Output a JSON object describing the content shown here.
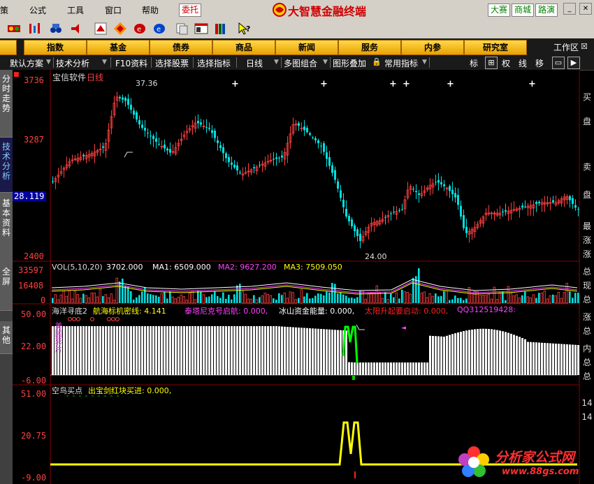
{
  "menu": {
    "items": [
      "策",
      "公式",
      "工具",
      "窗口",
      "帮助"
    ],
    "delegate": "委托",
    "app_title": "大智慧金融终端",
    "right_tabs": [
      "大赛",
      "商城",
      "路演"
    ]
  },
  "nav": {
    "buttons": [
      "指数",
      "基金",
      "债券",
      "商品",
      "新闻",
      "服务",
      "内参",
      "研究室"
    ],
    "workarea": "工作区"
  },
  "chart_toolbar": {
    "items": [
      "默认方案",
      "技术分析",
      "F10资料",
      "选择股票",
      "选择指标",
      "日线",
      "多图组合",
      "图形叠加",
      "常用指标"
    ],
    "boxes": [
      "标",
      "权",
      "线",
      "移"
    ]
  },
  "left_tabs": [
    "分时走势",
    "技术分析",
    "基本资料",
    "全屏",
    "其他"
  ],
  "price_panel": {
    "title": "宝信软件",
    "period": "日线",
    "y_labels": [
      "3736",
      "3287",
      "2400"
    ],
    "current": "28.119",
    "high_label": "37.36",
    "low_label": "24.00",
    "colors": {
      "up": "#ff4040",
      "down": "#00e0e0"
    }
  },
  "vol_panel": {
    "name": "VOL(5,10,20)",
    "value": "3702.000",
    "ma1": "MA1: 6509.000",
    "ma2": "MA2: 9627.200",
    "ma3": "MA3: 7509.050",
    "y_labels": [
      "33597",
      "16408",
      "0"
    ]
  },
  "ind1_panel": {
    "name": "海洋寻底2",
    "items": [
      {
        "text": "航海标机密线: 4.141",
        "color": "#ffff00"
      },
      {
        "text": "泰塔尼克号启航: 0.000,",
        "color": "#ff40ff"
      },
      {
        "text": "冰山资金能量: 0.000,",
        "color": "#ffffff"
      },
      {
        "text": "太阳升起要启动: 0.000,",
        "color": "#ff2020"
      },
      {
        "text": "QQ312519428:",
        "color": "#ff40ff"
      }
    ],
    "y_labels": [
      "50.00",
      "22.00",
      "-6.00"
    ],
    "side_label": "美国彩片"
  },
  "ind2_panel": {
    "name": "空鸟买点",
    "item": "出宝剑红块买进: 0.000,",
    "y_labels": [
      "51.00",
      "20.75",
      "-9.00"
    ]
  },
  "right_col": {
    "labels": [
      "买",
      "盘",
      "卖",
      "盘",
      "最",
      "涨",
      "涨",
      "总",
      "现",
      "总",
      "涨",
      "总",
      "内",
      "总",
      "总"
    ],
    "nums": [
      "14",
      "14"
    ]
  },
  "watermark": {
    "text": "分析家公式网",
    "url": "www.88gs.com"
  }
}
